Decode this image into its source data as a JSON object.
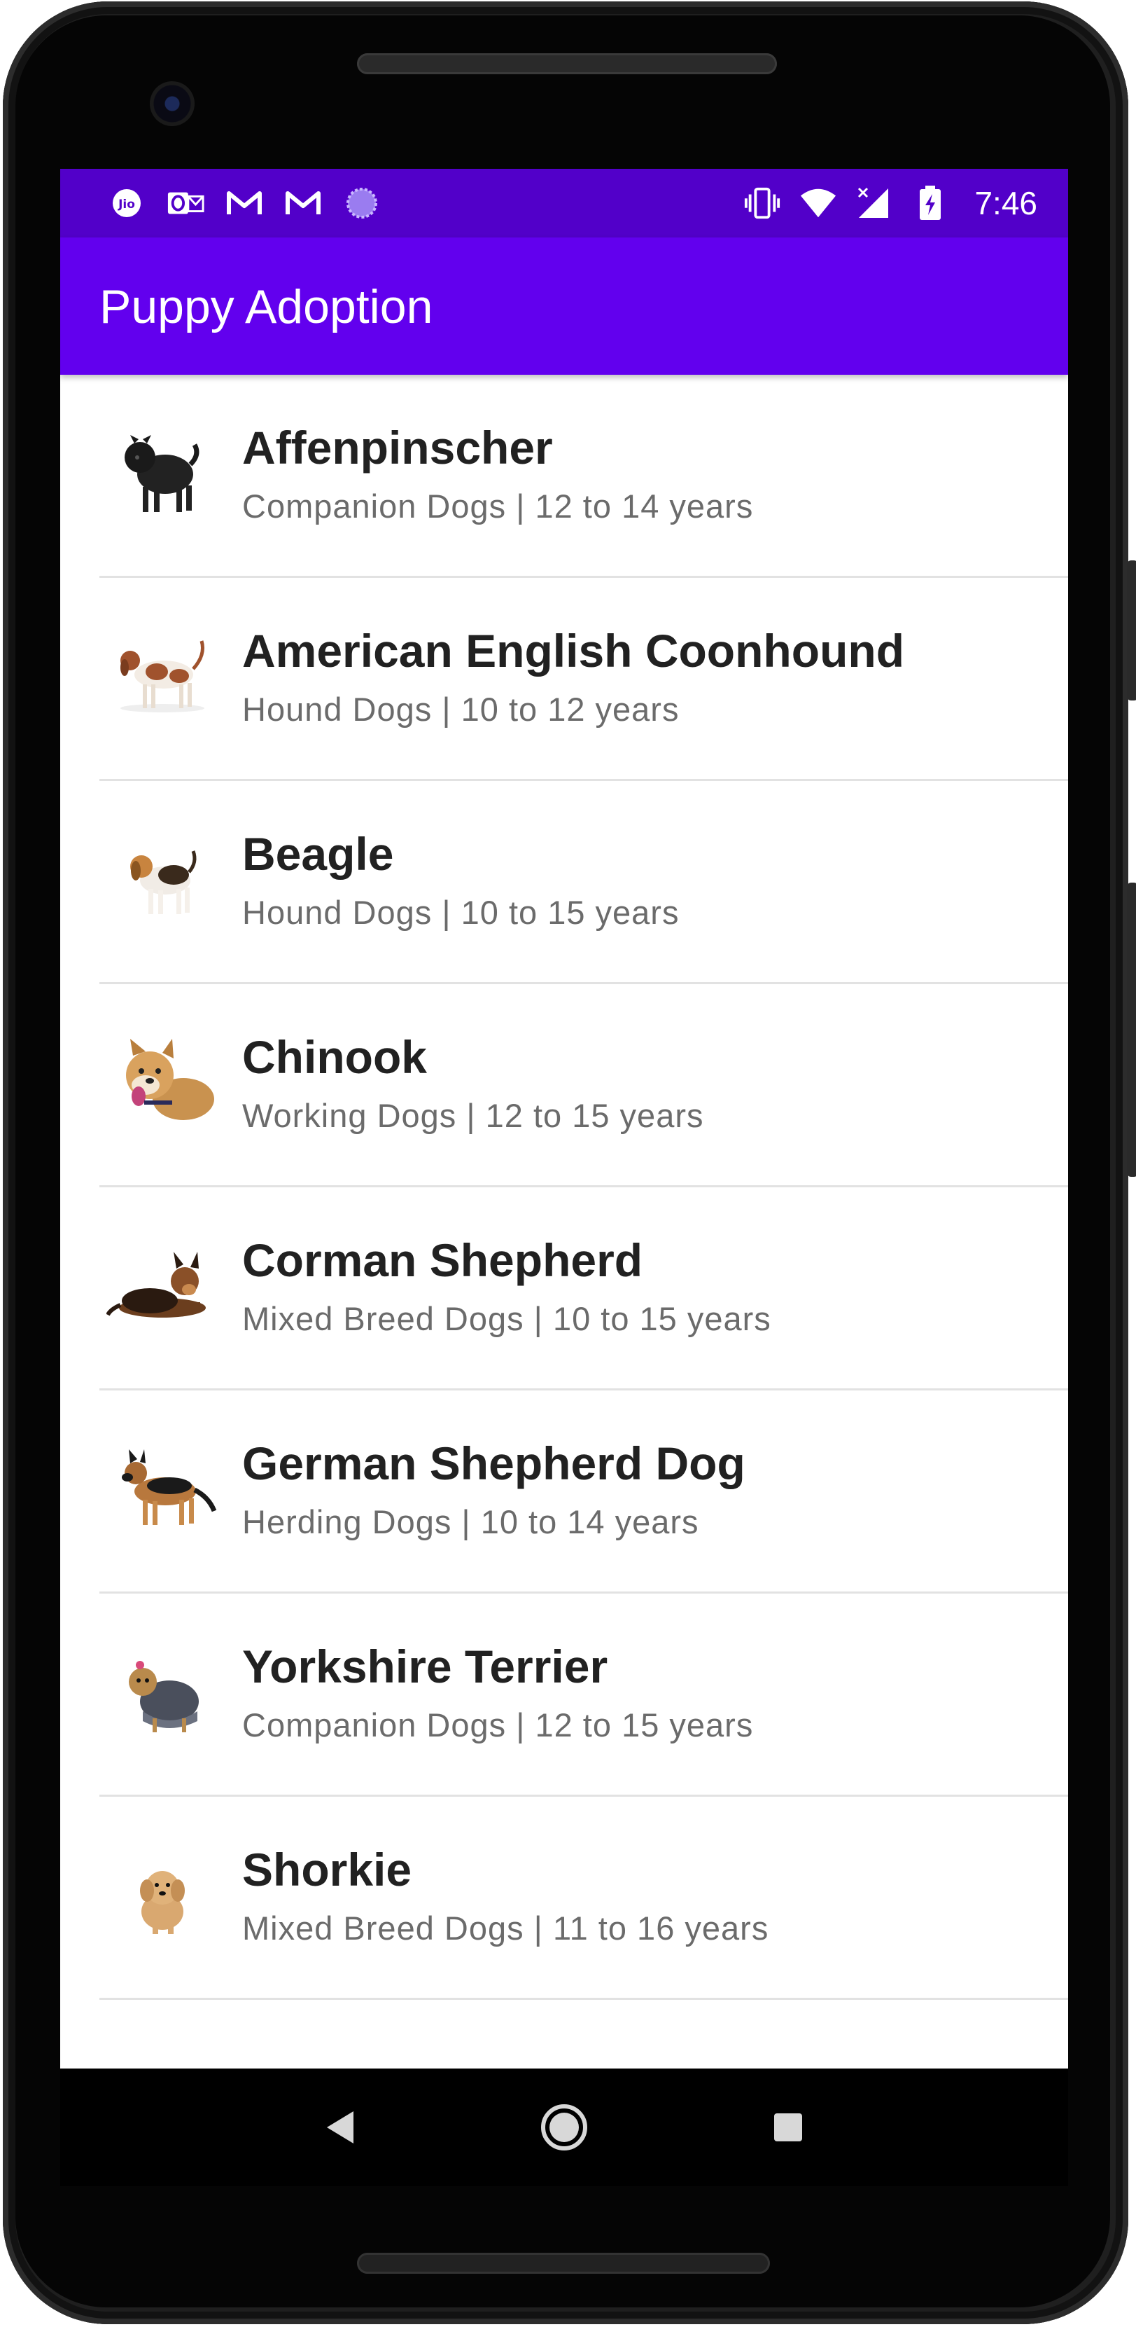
{
  "status_bar": {
    "time": "7:46",
    "left_icons": [
      "jio-icon",
      "outlook-icon",
      "gmail-icon",
      "gmail-icon",
      "sync-icon"
    ],
    "right_icons": [
      "vibrate-icon",
      "wifi-icon",
      "cell-signal-icon",
      "battery-charging-icon"
    ],
    "jio_text": "Jio",
    "colors": {
      "background": "#5200c9"
    }
  },
  "app_bar": {
    "title": "Puppy Adoption",
    "colors": {
      "primary": "#6200ee"
    }
  },
  "list": {
    "items": [
      {
        "name": "Affenpinscher",
        "details": "Companion Dogs | 12 to 14 years",
        "image": "affenpinscher-dog-image"
      },
      {
        "name": "American English Coonhound",
        "details": "Hound Dogs | 10 to 12 years",
        "image": "coonhound-dog-image"
      },
      {
        "name": "Beagle",
        "details": "Hound Dogs | 10 to 15 years",
        "image": "beagle-dog-image"
      },
      {
        "name": "Chinook",
        "details": "Working Dogs | 12 to 15 years",
        "image": "chinook-dog-image"
      },
      {
        "name": "Corman Shepherd",
        "details": "Mixed Breed Dogs | 10 to 15 years",
        "image": "corman-shepherd-dog-image"
      },
      {
        "name": "German Shepherd Dog",
        "details": "Herding Dogs | 10 to 14 years",
        "image": "german-shepherd-dog-image"
      },
      {
        "name": "Yorkshire Terrier",
        "details": "Companion Dogs | 12 to 15 years",
        "image": "yorkshire-terrier-dog-image"
      },
      {
        "name": "Shorkie",
        "details": "Mixed Breed Dogs | 11 to 16 years",
        "image": "shorkie-dog-image"
      }
    ]
  },
  "nav_bar": {
    "buttons": [
      "back-icon",
      "home-icon",
      "recents-icon"
    ]
  }
}
